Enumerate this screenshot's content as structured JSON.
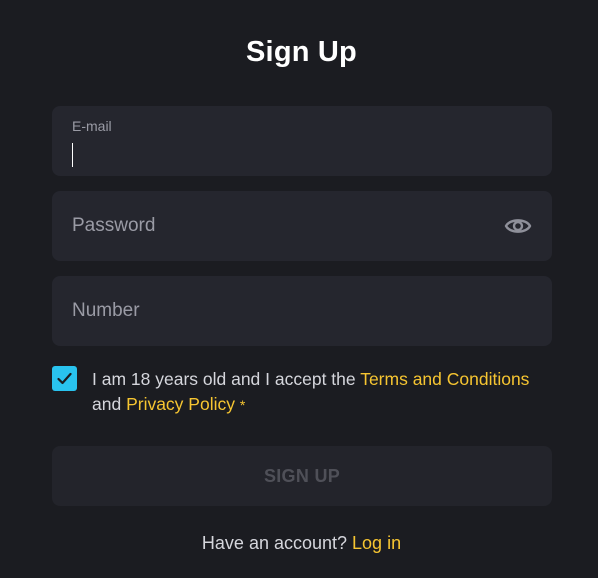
{
  "title": "Sign Up",
  "fields": {
    "email": {
      "label": "E-mail",
      "value": ""
    },
    "password": {
      "placeholder": "Password",
      "icon": "eye-icon"
    },
    "number": {
      "placeholder": "Number"
    }
  },
  "consent": {
    "checked": true,
    "text_part1": "I am 18 years old and I accept the ",
    "terms_link": "Terms and Conditions",
    "text_part2": "and ",
    "privacy_link": "Privacy Policy",
    "required_mark": "*"
  },
  "signup_button": "SIGN UP",
  "footer": {
    "prompt": "Have an account? ",
    "login_link": "Log in"
  },
  "colors": {
    "background": "#1b1c21",
    "field_bg": "#25262e",
    "accent_link": "#f6c531",
    "checkbox": "#29c3ef",
    "disabled_text": "#4f5058"
  }
}
